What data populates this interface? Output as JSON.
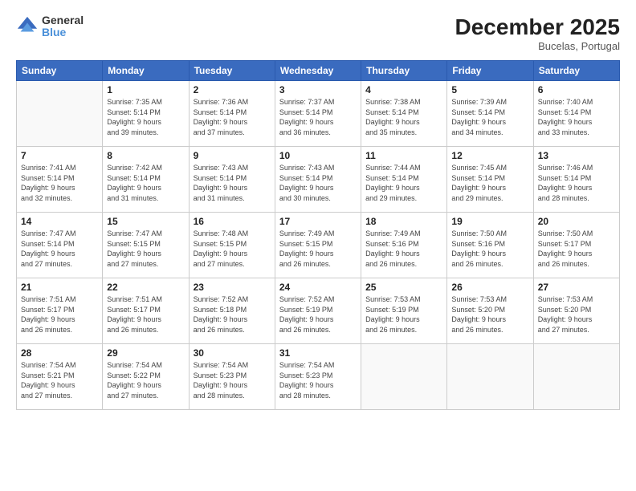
{
  "header": {
    "logo_line1": "General",
    "logo_line2": "Blue",
    "month": "December 2025",
    "location": "Bucelas, Portugal"
  },
  "weekdays": [
    "Sunday",
    "Monday",
    "Tuesday",
    "Wednesday",
    "Thursday",
    "Friday",
    "Saturday"
  ],
  "weeks": [
    [
      {
        "day": "",
        "info": ""
      },
      {
        "day": "1",
        "info": "Sunrise: 7:35 AM\nSunset: 5:14 PM\nDaylight: 9 hours\nand 39 minutes."
      },
      {
        "day": "2",
        "info": "Sunrise: 7:36 AM\nSunset: 5:14 PM\nDaylight: 9 hours\nand 37 minutes."
      },
      {
        "day": "3",
        "info": "Sunrise: 7:37 AM\nSunset: 5:14 PM\nDaylight: 9 hours\nand 36 minutes."
      },
      {
        "day": "4",
        "info": "Sunrise: 7:38 AM\nSunset: 5:14 PM\nDaylight: 9 hours\nand 35 minutes."
      },
      {
        "day": "5",
        "info": "Sunrise: 7:39 AM\nSunset: 5:14 PM\nDaylight: 9 hours\nand 34 minutes."
      },
      {
        "day": "6",
        "info": "Sunrise: 7:40 AM\nSunset: 5:14 PM\nDaylight: 9 hours\nand 33 minutes."
      }
    ],
    [
      {
        "day": "7",
        "info": "Sunrise: 7:41 AM\nSunset: 5:14 PM\nDaylight: 9 hours\nand 32 minutes."
      },
      {
        "day": "8",
        "info": "Sunrise: 7:42 AM\nSunset: 5:14 PM\nDaylight: 9 hours\nand 31 minutes."
      },
      {
        "day": "9",
        "info": "Sunrise: 7:43 AM\nSunset: 5:14 PM\nDaylight: 9 hours\nand 31 minutes."
      },
      {
        "day": "10",
        "info": "Sunrise: 7:43 AM\nSunset: 5:14 PM\nDaylight: 9 hours\nand 30 minutes."
      },
      {
        "day": "11",
        "info": "Sunrise: 7:44 AM\nSunset: 5:14 PM\nDaylight: 9 hours\nand 29 minutes."
      },
      {
        "day": "12",
        "info": "Sunrise: 7:45 AM\nSunset: 5:14 PM\nDaylight: 9 hours\nand 29 minutes."
      },
      {
        "day": "13",
        "info": "Sunrise: 7:46 AM\nSunset: 5:14 PM\nDaylight: 9 hours\nand 28 minutes."
      }
    ],
    [
      {
        "day": "14",
        "info": "Sunrise: 7:47 AM\nSunset: 5:14 PM\nDaylight: 9 hours\nand 27 minutes."
      },
      {
        "day": "15",
        "info": "Sunrise: 7:47 AM\nSunset: 5:15 PM\nDaylight: 9 hours\nand 27 minutes."
      },
      {
        "day": "16",
        "info": "Sunrise: 7:48 AM\nSunset: 5:15 PM\nDaylight: 9 hours\nand 27 minutes."
      },
      {
        "day": "17",
        "info": "Sunrise: 7:49 AM\nSunset: 5:15 PM\nDaylight: 9 hours\nand 26 minutes."
      },
      {
        "day": "18",
        "info": "Sunrise: 7:49 AM\nSunset: 5:16 PM\nDaylight: 9 hours\nand 26 minutes."
      },
      {
        "day": "19",
        "info": "Sunrise: 7:50 AM\nSunset: 5:16 PM\nDaylight: 9 hours\nand 26 minutes."
      },
      {
        "day": "20",
        "info": "Sunrise: 7:50 AM\nSunset: 5:17 PM\nDaylight: 9 hours\nand 26 minutes."
      }
    ],
    [
      {
        "day": "21",
        "info": "Sunrise: 7:51 AM\nSunset: 5:17 PM\nDaylight: 9 hours\nand 26 minutes."
      },
      {
        "day": "22",
        "info": "Sunrise: 7:51 AM\nSunset: 5:17 PM\nDaylight: 9 hours\nand 26 minutes."
      },
      {
        "day": "23",
        "info": "Sunrise: 7:52 AM\nSunset: 5:18 PM\nDaylight: 9 hours\nand 26 minutes."
      },
      {
        "day": "24",
        "info": "Sunrise: 7:52 AM\nSunset: 5:19 PM\nDaylight: 9 hours\nand 26 minutes."
      },
      {
        "day": "25",
        "info": "Sunrise: 7:53 AM\nSunset: 5:19 PM\nDaylight: 9 hours\nand 26 minutes."
      },
      {
        "day": "26",
        "info": "Sunrise: 7:53 AM\nSunset: 5:20 PM\nDaylight: 9 hours\nand 26 minutes."
      },
      {
        "day": "27",
        "info": "Sunrise: 7:53 AM\nSunset: 5:20 PM\nDaylight: 9 hours\nand 27 minutes."
      }
    ],
    [
      {
        "day": "28",
        "info": "Sunrise: 7:54 AM\nSunset: 5:21 PM\nDaylight: 9 hours\nand 27 minutes."
      },
      {
        "day": "29",
        "info": "Sunrise: 7:54 AM\nSunset: 5:22 PM\nDaylight: 9 hours\nand 27 minutes."
      },
      {
        "day": "30",
        "info": "Sunrise: 7:54 AM\nSunset: 5:23 PM\nDaylight: 9 hours\nand 28 minutes."
      },
      {
        "day": "31",
        "info": "Sunrise: 7:54 AM\nSunset: 5:23 PM\nDaylight: 9 hours\nand 28 minutes."
      },
      {
        "day": "",
        "info": ""
      },
      {
        "day": "",
        "info": ""
      },
      {
        "day": "",
        "info": ""
      }
    ]
  ]
}
